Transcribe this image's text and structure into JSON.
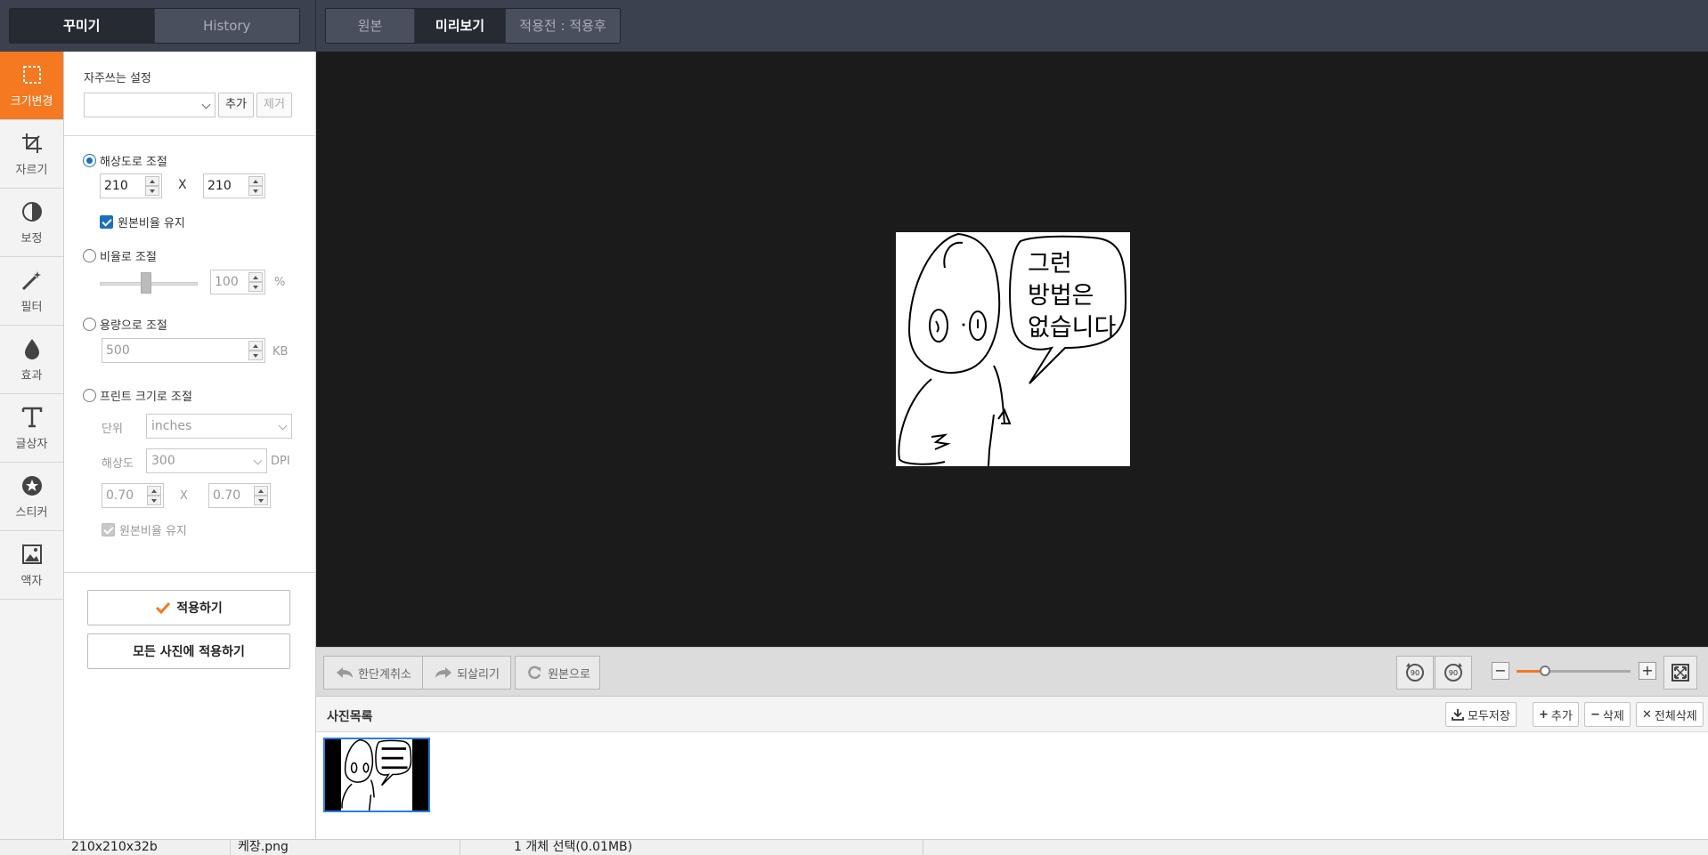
{
  "top": {
    "left_tabs": [
      "꾸미기",
      "History"
    ],
    "view_tabs": [
      "원본",
      "미리보기",
      "적용전 : 적용후"
    ]
  },
  "tools": [
    {
      "label": "크기변경",
      "icon": "resize-icon"
    },
    {
      "label": "자르기",
      "icon": "crop-icon"
    },
    {
      "label": "보정",
      "icon": "adjust-icon"
    },
    {
      "label": "필터",
      "icon": "filter-wand-icon"
    },
    {
      "label": "효과",
      "icon": "drop-icon"
    },
    {
      "label": "글상자",
      "icon": "text-icon"
    },
    {
      "label": "스티커",
      "icon": "sticker-icon"
    },
    {
      "label": "액자",
      "icon": "frame-icon"
    }
  ],
  "panel": {
    "favorites_title": "자주쓰는 설정",
    "favorites_value": "",
    "add_label": "추가",
    "remove_label": "제거",
    "by_resolution": "해상도로 조절",
    "width": "210",
    "height": "210",
    "times": "X",
    "keep_ratio": "원본비율 유지",
    "by_ratio": "비율로 조절",
    "ratio_value": "100",
    "ratio_unit": "%",
    "by_size": "용량으로 조절",
    "size_value": "500",
    "size_unit": "KB",
    "by_print": "프린트 크기로 조절",
    "unit_label": "단위",
    "unit_value": "inches",
    "dpi_label": "해상도",
    "dpi_value": "300",
    "dpi_unit": "DPI",
    "print_w": "0.70",
    "print_h": "0.70",
    "print_keep_ratio": "원본비율 유지",
    "apply": "적용하기",
    "apply_all": "모든 사진에 적용하기"
  },
  "image_text": [
    "그런",
    "방법은",
    "없습니다"
  ],
  "canvas_toolbar": {
    "undo": "한단계취소",
    "redo": "되살리기",
    "reset": "원본으로",
    "rotate_left": "90",
    "rotate_right": "90"
  },
  "photo_list": {
    "title": "사진목록",
    "save_all": "모두저장",
    "add": "추가",
    "delete": "삭제",
    "delete_all": "전체삭제"
  },
  "status": {
    "dims": "210x210x32b",
    "file": "케장.png",
    "selection": "1 개체 선택(0.01MB)"
  },
  "colors": {
    "accent": "#f47920",
    "selection": "#2a7de1",
    "radio": "#1b6fc2"
  }
}
